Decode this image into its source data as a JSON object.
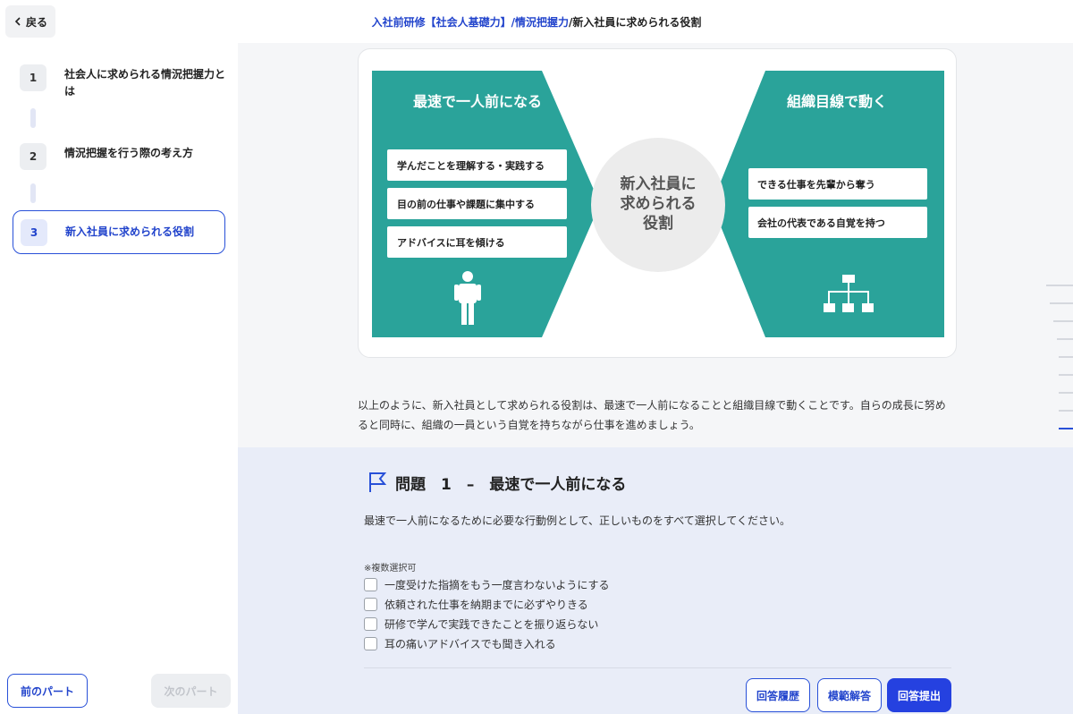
{
  "header": {
    "back_label": "戻る",
    "breadcrumb": {
      "course": "入社前研修【社会人基礎力】",
      "sep1": "/",
      "section": "情況把握力",
      "sep2": "/",
      "current": "新入社員に求められる役割"
    }
  },
  "sidebar": {
    "steps": [
      {
        "num": "1",
        "label_line1": "社会人に求められる情況把握力と",
        "label_line2": "は"
      },
      {
        "num": "2",
        "label": "情況把握を行う際の考え方"
      },
      {
        "num": "3",
        "label": "新入社員に求められる役割"
      }
    ],
    "prev_label": "前のパート",
    "next_label": "次のパート"
  },
  "figure": {
    "left_title": "最速で一人前になる",
    "left_items": [
      "学んだことを理解する・実践する",
      "目の前の仕事や課題に集中する",
      "アドバイスに耳を傾ける"
    ],
    "center_line1": "新入社員に",
    "center_line2": "求められる",
    "center_line3": "役割",
    "right_title": "組織目線で動く",
    "right_items": [
      "できる仕事を先輩から奪う",
      "会社の代表である自覚を持つ"
    ],
    "teal_color": "#2aa39a",
    "circle_color": "#ececec",
    "person_icon": "person-icon",
    "org_icon": "org-chart-icon"
  },
  "description": {
    "line1": "以上のように、新入社員として求められる役割は、最速で一人前になることと組織目線で動くことです。自らの成長に努め",
    "line2": "ると同時に、組織の一員という自覚を持ちながら仕事を進めましょう。"
  },
  "question": {
    "title": "問題　1　–　最速で一人前になる",
    "body": "最速で一人前になるために必要な行動例として、正しいものをすべて選択してください。",
    "note": "※複数選択可",
    "options": [
      "一度受けた指摘をもう一度言わないようにする",
      "依頼された仕事を納期までに必ずやりきる",
      "研修で学んで実践できたことを振り返らない",
      "耳の痛いアドバイスでも聞き入れる"
    ],
    "history_label": "回答履歴",
    "model_label": "模範解答",
    "submit_label": "回答提出"
  },
  "colors": {
    "accent": "#2850d8",
    "submit": "#2541e0"
  }
}
